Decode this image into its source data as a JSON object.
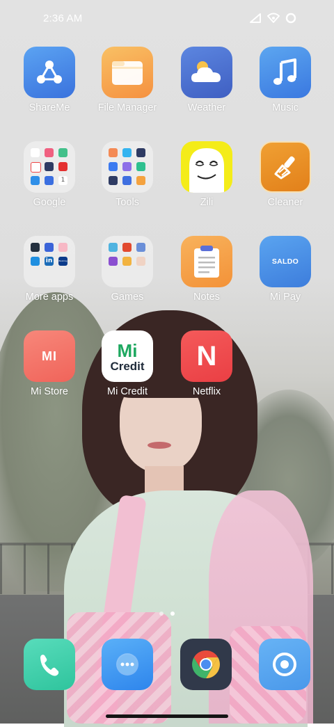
{
  "status_bar": {
    "time": "2:36 AM"
  },
  "apps": [
    {
      "label": "ShareMe"
    },
    {
      "label": "File Manager"
    },
    {
      "label": "Weather"
    },
    {
      "label": "Music"
    },
    {
      "label": "Google"
    },
    {
      "label": "Tools"
    },
    {
      "label": "Zili"
    },
    {
      "label": "Cleaner"
    },
    {
      "label": "More apps"
    },
    {
      "label": "Games"
    },
    {
      "label": "Notes"
    },
    {
      "label": "Mi Pay",
      "icon_text": "SALDO"
    },
    {
      "label": "Mi Store",
      "icon_text": "MI"
    },
    {
      "label": "Mi Credit",
      "icon_text_top": "Mi",
      "icon_text_bottom": "Credit"
    },
    {
      "label": "Netflix",
      "icon_text": "N"
    }
  ],
  "folders": {
    "more_apps_tiles": {
      "linkedin": "in",
      "booking": "Booking"
    },
    "google_tiles": {
      "one": "1"
    }
  },
  "page_indicator": {
    "count": 2,
    "active_index": 1
  },
  "dock": [
    "phone-icon",
    "messages-icon",
    "browser-icon",
    "camera-icon"
  ],
  "colors": {
    "shareme": "#4a8be8",
    "file_manager": "#f7a84a",
    "weather": "#4e74d0",
    "music": "#4a90e2",
    "cleaner": "#e89025",
    "notes": "#f5a04a",
    "mipay": "#4a8fdd",
    "mistore": "#f26a55",
    "netflix": "#f04a4d",
    "phone": "#3ccfa8",
    "messages": "#3d8ff0"
  }
}
